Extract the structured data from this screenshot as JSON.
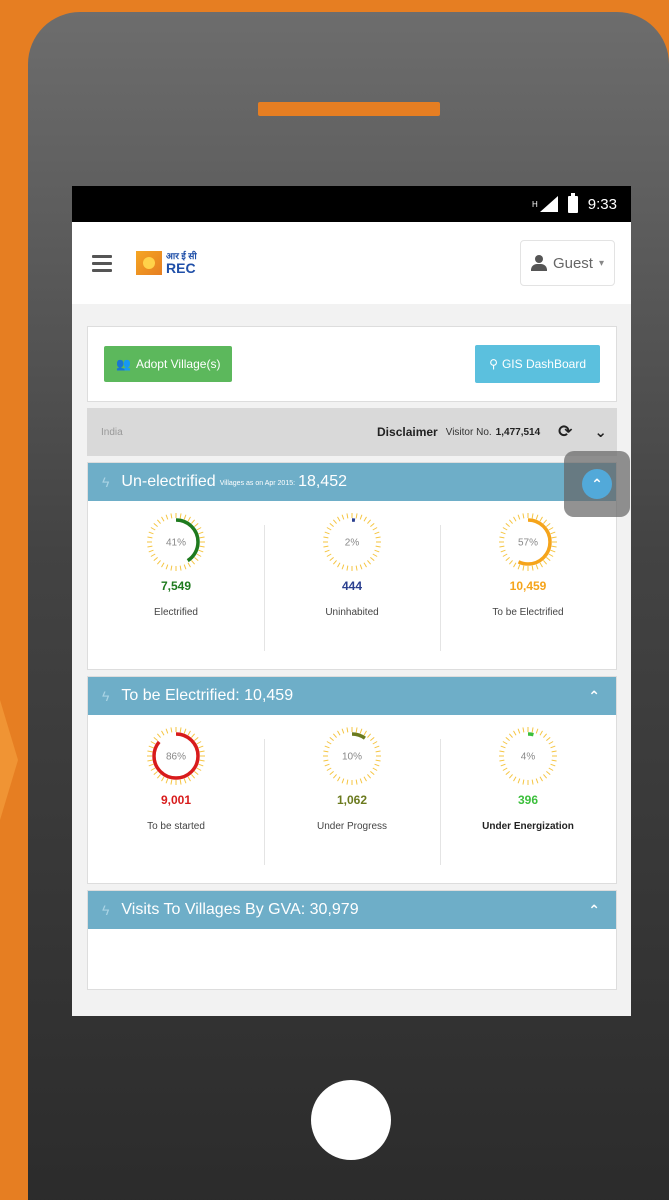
{
  "status": {
    "network": "H",
    "time": "9:33"
  },
  "header": {
    "logo": {
      "hindi": "आर ई सी",
      "name": "REC",
      "tagline": ""
    },
    "user_label": "Guest"
  },
  "actions": {
    "adopt_label": "Adopt Village(s)",
    "gis_label": "GIS DashBoard"
  },
  "filter": {
    "region": "India",
    "disclaimer": "Disclaimer",
    "visitor_label": "Visitor No.",
    "visitor_count": "1,477,514"
  },
  "sections": [
    {
      "title": "Un-electrified",
      "subtitle": "Villages as on Apr 2015:",
      "total": "18,452",
      "stats": [
        {
          "pct": 41,
          "pct_label": "41%",
          "value": "7,549",
          "label": "Electrified",
          "color": "#1e7a1e"
        },
        {
          "pct": 2,
          "pct_label": "2%",
          "value": "444",
          "label": "Uninhabited",
          "color": "#2a3f8f"
        },
        {
          "pct": 57,
          "pct_label": "57%",
          "value": "10,459",
          "label": "To be Electrified",
          "color": "#f5a41b"
        }
      ]
    },
    {
      "title": "To be Electrified: 10,459",
      "stats": [
        {
          "pct": 86,
          "pct_label": "86%",
          "value": "9,001",
          "label": "To be started",
          "color": "#d81b1b"
        },
        {
          "pct": 10,
          "pct_label": "10%",
          "value": "1,062",
          "label": "Under Progress",
          "color": "#6b7a1e"
        },
        {
          "pct": 4,
          "pct_label": "4%",
          "value": "396",
          "label": "Under Energization",
          "color": "#3cbf3c"
        }
      ]
    },
    {
      "title": "Visits To Villages By GVA: 30,979"
    }
  ],
  "colors": {
    "accent_orange": "#e67e22",
    "section_header": "#6eaec8",
    "adopt_green": "#5cb85c",
    "gis_blue": "#5bc0de"
  }
}
